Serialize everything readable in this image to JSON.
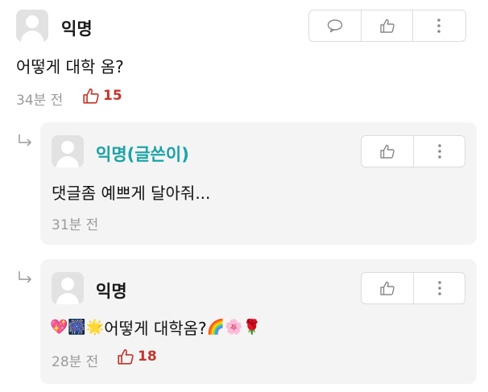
{
  "post": {
    "author": "익명",
    "content": "어떻게 대학 옴?",
    "time": "34분 전",
    "likes": "15"
  },
  "replies": [
    {
      "author": "익명(글쓴이)",
      "content": "댓글좀 예쁘게 달아줘...",
      "time": "31분 전"
    },
    {
      "author": "익명",
      "content_text": "어떻게 대학옴?",
      "emojis_before": [
        "💖",
        "🎆",
        "🌟"
      ],
      "emojis_after": [
        "🌈",
        "🌸",
        "🌹"
      ],
      "time": "28분 전",
      "likes": "18"
    }
  ],
  "icons": {
    "comment": "comment-icon",
    "like": "thumbs-up-icon",
    "more": "more-vertical-icon",
    "reply_arrow": "reply-arrow-icon"
  },
  "colors": {
    "op_author": "#1aa3a8",
    "like_count": "#c4352b",
    "meta": "#9b9b9b",
    "reply_bg": "#f4f4f4"
  }
}
